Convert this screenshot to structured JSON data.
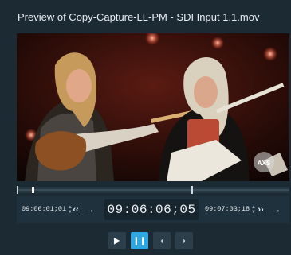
{
  "window": {
    "title": "Preview of Copy-Capture-LL-PM - SDI Input 1.1.mov"
  },
  "video": {
    "watermark": "AXS"
  },
  "scrubber": {
    "playhead_fraction": 0.055
  },
  "controls": {
    "in_timecode": "09:06:01;01",
    "out_timecode": "09:07:03;18",
    "current_timecode": "09:06:06;05",
    "goto_in_icon": "skip-to-in-icon",
    "goto_out_icon": "skip-to-out-icon"
  },
  "transport": {
    "play_icon": "play-icon",
    "pause_icon": "pause-icon",
    "prev_icon": "chevron-left-icon",
    "next_icon": "chevron-right-icon"
  },
  "colors": {
    "accent": "#2ea6e0",
    "background": "#1c2a34"
  }
}
